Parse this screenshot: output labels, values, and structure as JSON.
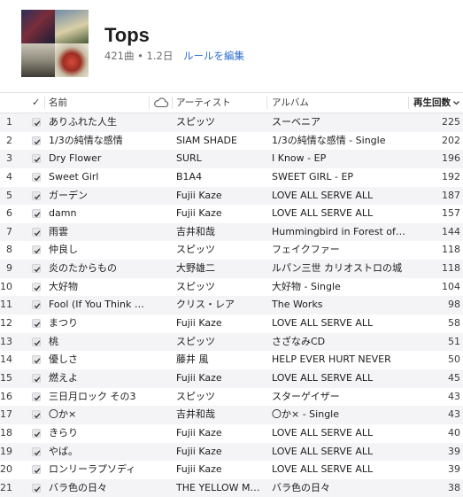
{
  "playlist": {
    "title": "Tops",
    "meta": "421曲 • 1.2日",
    "edit_rules_label": "ルールを編集"
  },
  "columns": {
    "check": "✓",
    "name": "名前",
    "cloud_icon": "cloud-icon",
    "artist": "アーティスト",
    "album": "アルバム",
    "plays": "再生回数",
    "sort_indicator": "chevron-down-icon"
  },
  "colors": {
    "link": "#2f6fd0",
    "stripe": "#f4f4f6"
  },
  "tracks": [
    {
      "num": "1",
      "name": "ありふれた人生",
      "artist": "スピッツ",
      "album": "スーベニア",
      "plays": "225"
    },
    {
      "num": "2",
      "name": "1/3の純情な感情",
      "artist": "SIAM SHADE",
      "album": "1/3の純情な感情 - Single",
      "plays": "202"
    },
    {
      "num": "3",
      "name": "Dry Flower",
      "artist": "SURL",
      "album": "I Know - EP",
      "plays": "196"
    },
    {
      "num": "4",
      "name": "Sweet Girl",
      "artist": "B1A4",
      "album": "SWEET GIRL - EP",
      "plays": "192"
    },
    {
      "num": "5",
      "name": "ガーデン",
      "artist": "Fujii Kaze",
      "album": "LOVE ALL SERVE ALL",
      "plays": "187"
    },
    {
      "num": "6",
      "name": "damn",
      "artist": "Fujii Kaze",
      "album": "LOVE ALL SERVE ALL",
      "plays": "157"
    },
    {
      "num": "7",
      "name": "雨雲",
      "artist": "吉井和哉",
      "album": "Hummingbird in Forest of S...",
      "plays": "144"
    },
    {
      "num": "8",
      "name": "仲良し",
      "artist": "スピッツ",
      "album": "フェイクファー",
      "plays": "118"
    },
    {
      "num": "9",
      "name": "炎のたからもの",
      "artist": "大野雄二",
      "album": "ルパン三世 カリオストロの城",
      "plays": "118"
    },
    {
      "num": "10",
      "name": "大好物",
      "artist": "スピッツ",
      "album": "大好物 - Single",
      "plays": "104"
    },
    {
      "num": "11",
      "name": "Fool (If You Think It'...",
      "artist": "クリス・レア",
      "album": "The Works",
      "plays": "98"
    },
    {
      "num": "12",
      "name": "まつり",
      "artist": "Fujii Kaze",
      "album": "LOVE ALL SERVE ALL",
      "plays": "58"
    },
    {
      "num": "13",
      "name": "桃",
      "artist": "スピッツ",
      "album": "さざなみCD",
      "plays": "51"
    },
    {
      "num": "14",
      "name": "優しさ",
      "artist": "藤井 風",
      "album": "HELP EVER HURT NEVER",
      "plays": "50"
    },
    {
      "num": "15",
      "name": "燃えよ",
      "artist": "Fujii Kaze",
      "album": "LOVE ALL SERVE ALL",
      "plays": "45"
    },
    {
      "num": "16",
      "name": "三日月ロック その3",
      "artist": "スピッツ",
      "album": "スターゲイザー",
      "plays": "43"
    },
    {
      "num": "17",
      "name": "〇か×",
      "artist": "吉井和哉",
      "album": "〇か× - Single",
      "plays": "43"
    },
    {
      "num": "18",
      "name": "きらり",
      "artist": "Fujii Kaze",
      "album": "LOVE ALL SERVE ALL",
      "plays": "40"
    },
    {
      "num": "19",
      "name": "やば。",
      "artist": "Fujii Kaze",
      "album": "LOVE ALL SERVE ALL",
      "plays": "39"
    },
    {
      "num": "20",
      "name": "ロンリーラプソディ",
      "artist": "Fujii Kaze",
      "album": "LOVE ALL SERVE ALL",
      "plays": "39"
    },
    {
      "num": "21",
      "name": "バラ色の日々",
      "artist": "THE YELLOW MO...",
      "album": "バラ色の日々",
      "plays": "38"
    }
  ]
}
